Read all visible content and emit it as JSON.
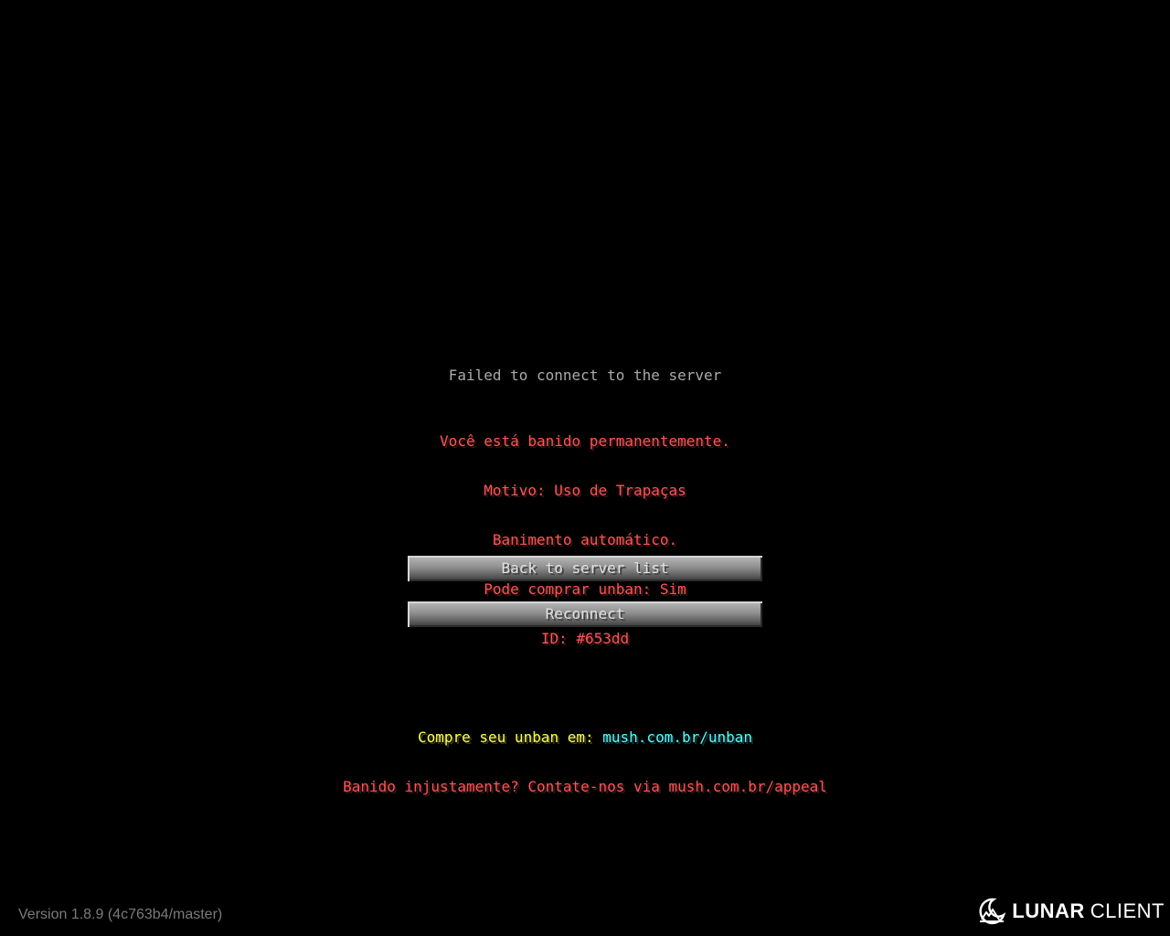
{
  "screen": {
    "title": "Failed to connect to the server",
    "ban_lines": [
      "Você está banido permanentemente.",
      "Motivo: Uso de Trapaças",
      "Banimento automático.",
      "Pode comprar unban: Sim",
      "ID: #653dd"
    ],
    "unban_prefix": "Compre seu unban em: ",
    "unban_link": "mush.com.br/unban",
    "appeal_line": "Banido injustamente? Contate-nos via mush.com.br/appeal"
  },
  "buttons": {
    "back_label": "Back to server list",
    "reconnect_label": "Reconnect"
  },
  "footer": {
    "version": "Version 1.8.9 (4c763b4/master)",
    "brand_bold": "LUNAR",
    "brand_light": "CLIENT",
    "brand_icon": "lunar-client-logo"
  },
  "colors": {
    "background": "#000000",
    "title": "#aaaaaa",
    "ban_text": "#ff5555",
    "unban_prefix": "#ffff55",
    "unban_link": "#55ffff"
  }
}
